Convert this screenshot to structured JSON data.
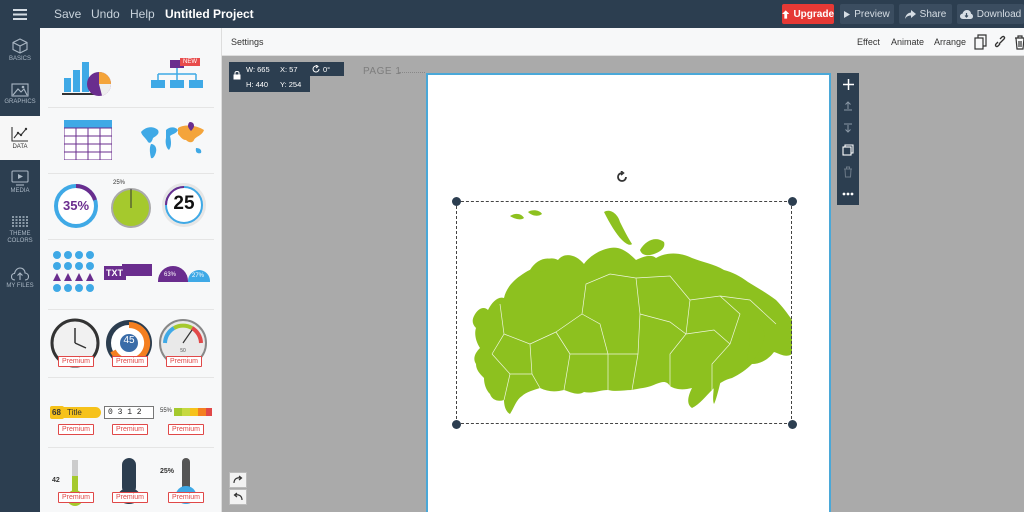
{
  "topbar": {
    "save": "Save",
    "undo": "Undo",
    "help": "Help",
    "project_title": "Untitled Project",
    "upgrade": "Upgrade",
    "preview": "Preview",
    "share": "Share",
    "download": "Download"
  },
  "nav": {
    "items": [
      {
        "label": "BASICS",
        "icon": "cube-icon"
      },
      {
        "label": "GRAPHICS",
        "icon": "image-icon"
      },
      {
        "label": "DATA",
        "icon": "chart-icon"
      },
      {
        "label": "MEDIA",
        "icon": "play-icon"
      },
      {
        "label": "THEME COLORS",
        "icon": "pattern-icon"
      },
      {
        "label": "MY FILES",
        "icon": "upload-icon"
      }
    ],
    "active": "DATA"
  },
  "panel": {
    "new_badge": "NEW",
    "progress_circle": "35%",
    "small_gauge": "25%",
    "counter_number": "25",
    "text_block": "TXT",
    "semi_1": "63%",
    "semi_2": "27%",
    "dial_value": "45",
    "meter_value": "50",
    "badge_number": "68",
    "badge_title": "Title",
    "odometer": "0 3 1 2",
    "rating_bar": "55%",
    "thermo_value": "42",
    "thermo_value_2": "25%",
    "premium": "Premium"
  },
  "settingsbar": {
    "label": "Settings",
    "effect": "Effect",
    "animate": "Animate",
    "arrange": "Arrange"
  },
  "canvas": {
    "page_label": "PAGE 1",
    "width_label": "W: 665",
    "x_label": "X: 57",
    "rotation_label": "0°",
    "height_label": "H: 440",
    "y_label": "Y: 254"
  },
  "colors": {
    "topbar": "#2c3e50",
    "map_green": "#8dc11f",
    "upgrade_red": "#e53935",
    "page_border": "#4aa8d8",
    "premium_red": "#e04848"
  }
}
